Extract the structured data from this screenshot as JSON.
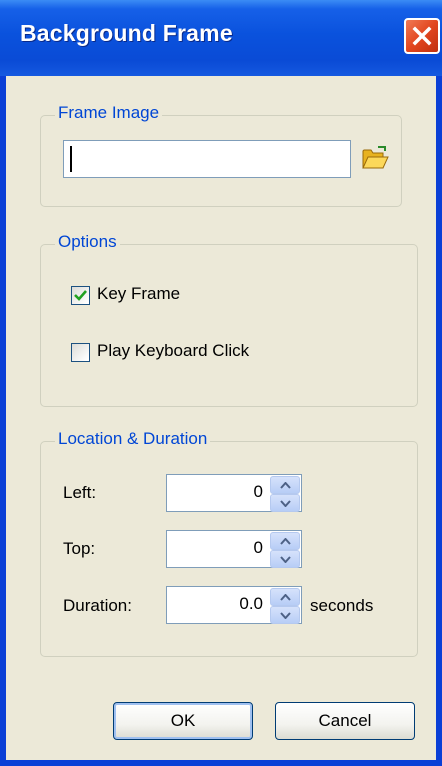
{
  "window": {
    "title": "Background Frame"
  },
  "icons": {
    "close": "close-icon",
    "browse": "folder-open-icon",
    "check": "checkmark-icon",
    "spin_up": "arrow-up-icon",
    "spin_down": "arrow-down-icon"
  },
  "frame_image": {
    "group_label": "Frame Image",
    "path_value": ""
  },
  "options": {
    "group_label": "Options",
    "key_frame": {
      "label": "Key Frame",
      "checked": true
    },
    "play_keyboard_click": {
      "label": "Play Keyboard Click",
      "checked": false
    }
  },
  "location": {
    "group_label": "Location & Duration",
    "left": {
      "label": "Left:",
      "value": "0"
    },
    "top": {
      "label": "Top:",
      "value": "0"
    },
    "duration": {
      "label": "Duration:",
      "value": "0.0",
      "unit": "seconds"
    }
  },
  "buttons": {
    "ok": "OK",
    "cancel": "Cancel"
  },
  "colors": {
    "title_bar": "#0a52dd",
    "dialog_bg": "#ece9d8",
    "group_label": "#0046d5",
    "close_button": "#e2461f"
  }
}
